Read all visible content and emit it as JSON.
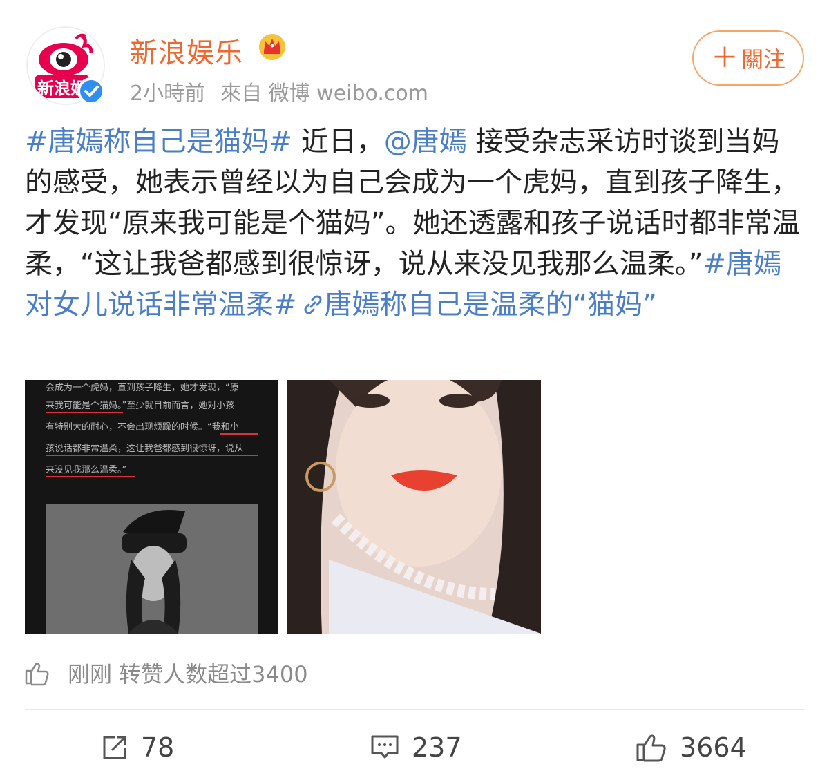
{
  "post": {
    "author": "新浪娱乐",
    "avatar_text": "新浪娱",
    "time": "2小時前",
    "source": "來自 微博 weibo.com",
    "follow_label": "關注",
    "content": {
      "topic1": "#唐嫣称自己是猫妈#",
      "text1": " 近日，",
      "mention": "@唐嫣",
      "text2": " 接受杂志采访时谈到当妈的感受，她表示曾经以为自己会成为一个虎妈，直到孩子降生，才发现“原来我可能是个猫妈”。她还透露和孩子说话时都非常温柔，“这让我爸都感到很惊讶，说从来没见我那么温柔。”",
      "topic2": "#唐嫣对女儿说话非常温柔#",
      "link": "唐嫣称自己是温柔的“猫妈”"
    },
    "image_left_lines": [
      "会成为一个虎妈，直到孩子降生，她才发现，“原",
      "来我可能是个猫妈。”至少就目前而言，她对小孩",
      "有特别大的耐心，不会出现烦躁的时候。“我和小",
      "孩说话都非常温柔，这让我爸都感到很惊讶，说从",
      "来没见我那么温柔。”"
    ],
    "repost_text": "刚刚 转赞人数超过3400",
    "actions": {
      "share_count": "78",
      "comment_count": "237",
      "like_count": "3664"
    }
  },
  "colors": {
    "author": "#f0682e",
    "link": "#4a7ec8",
    "muted": "#9a9a9a"
  }
}
